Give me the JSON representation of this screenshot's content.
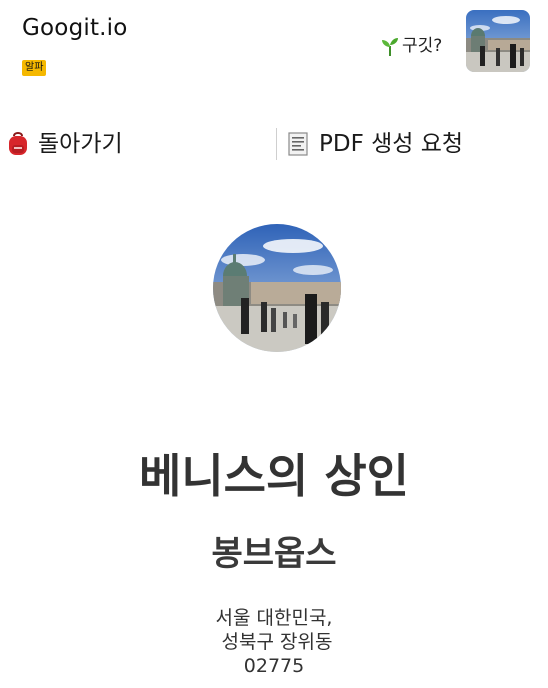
{
  "header": {
    "brand": "Googit.io",
    "badge": "알파",
    "help_label": "구깃?",
    "help_icon": "sprout-icon",
    "avatar_icon": "venice-photo"
  },
  "actions": {
    "back_label": "돌아가기",
    "back_icon": "backpack-icon",
    "pdf_label": "PDF 생성 요청",
    "pdf_icon": "receipt-icon"
  },
  "profile": {
    "avatar": "venice-photo",
    "book_title": "베니스의 상인",
    "author": "봉브옵스",
    "address_lines": [
      "서울 대한민국,",
      " 성북구 장위동",
      "02775"
    ]
  },
  "colors": {
    "badge": "#f5b800",
    "text": "#222222"
  }
}
